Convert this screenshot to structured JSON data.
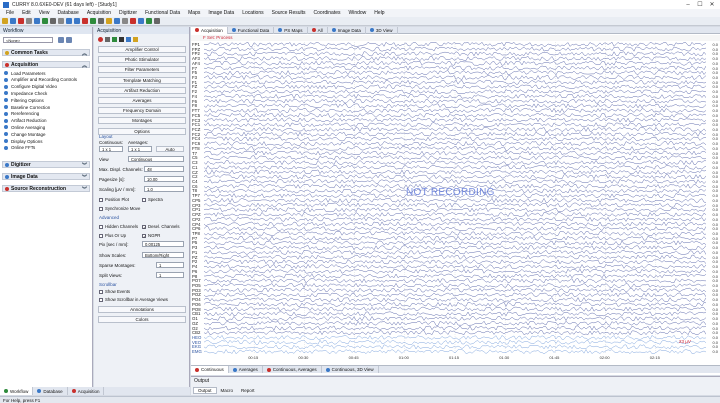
{
  "window": {
    "title": "CURRY 8.0.6XE0-DEV (61 days left) - [Study1]"
  },
  "menu": [
    "File",
    "Edit",
    "View",
    "Database",
    "Acquisition",
    "Digitizer",
    "Functional Data",
    "Maps",
    "Image Data",
    "Locations",
    "Source Results",
    "Coordinates",
    "Window",
    "Help"
  ],
  "workflow": {
    "title": "Workflow",
    "search_value": "<None>",
    "sections": [
      {
        "label": "Common Tasks",
        "color": "#d2a21f"
      },
      {
        "label": "Acquisition",
        "color": "#c9302c"
      }
    ],
    "acq_items": [
      "Load Parameters",
      "Amplifier and Recording Controls",
      "Configure Digital Video",
      "Impedance Check",
      "Filtering Options",
      "Baseline Correction",
      "Rereferencing",
      "Artifact Reduction",
      "Online Averaging",
      "Change Montage",
      "Display Options",
      "Online FFTs"
    ],
    "lower_sections": [
      {
        "label": "Digitizer",
        "color": "#3a78c7"
      },
      {
        "label": "Image Data",
        "color": "#3a78c7"
      },
      {
        "label": "Source Reconstruction",
        "color": "#c9302c"
      }
    ]
  },
  "acquisition": {
    "title": "Acquisition",
    "buttons": [
      "Amplifier Control",
      "Photic Stimulator",
      "Filter Parameters",
      "Template Matching",
      "Artifact Reduction",
      "Averages",
      "Frequency Domain",
      "Montages",
      "Options"
    ],
    "layout_group": "Layout",
    "continuous_label": "Continuous:",
    "averages_label": "Averages:",
    "continuous_value": "1 x 1",
    "averages_value": "1 x 1",
    "auto_label": "Auto",
    "view_label": "View",
    "view_value": "Continuous",
    "max_channels_label": "Max. Displ. Channels:",
    "max_channels_value": "48",
    "pagesize_label": "Pagesize [s]:",
    "pagesize_value": "10.00",
    "scaling_label": "Scaling [µV / mm]:",
    "scaling_value": "1.0",
    "position_plot": "Position Plot",
    "spectra": "Spectra",
    "sync_move": "Synchronize Move",
    "advanced_group": "Advanced",
    "hidden_channels": "Hidden Channels",
    "deselect_channels": "Desel. Channels",
    "plus_or_up": "Plus Or Up",
    "negp": "NGPR",
    "pix_label": "Pix [sec / mm]:",
    "pix_value": "0.00125",
    "show_scales_label": "Show Scales:",
    "show_scales_value": "Bottom/Right",
    "sparse_label": "Sparse Montages:",
    "sparse_value": "1",
    "split_label": "Split Views:",
    "split_value": "1",
    "scrollbar_group": "Scrollbar",
    "show_events": "Show Events",
    "show_scrollbar_avg": "Show Scrollbar in Average Views",
    "bottom_buttons": [
      "Annotations",
      "Colors"
    ]
  },
  "main": {
    "tabs": [
      {
        "label": "Acquisition",
        "color": "#c9302c"
      },
      {
        "label": "Functional Data",
        "color": "#3a78c7"
      },
      {
        "label": "PS Maps",
        "color": "#3a78c7"
      },
      {
        "label": "All",
        "color": "#c9302c"
      },
      {
        "label": "Image Data",
        "color": "#3a78c7"
      },
      {
        "label": "3D View",
        "color": "#3a78c7"
      }
    ],
    "header_label": "F Set: Process",
    "channels": [
      "FP1",
      "FPZ",
      "FP2",
      "AF3",
      "AF4",
      "F7",
      "F5",
      "F3",
      "F1",
      "FZ",
      "F2",
      "F4",
      "F6",
      "F8",
      "FT7",
      "FC5",
      "FC3",
      "FC1",
      "FCZ",
      "FC2",
      "FC4",
      "FC6",
      "FT8",
      "T7",
      "C5",
      "C3",
      "C1",
      "CZ",
      "C2",
      "C4",
      "C6",
      "T8",
      "TP7",
      "CP5",
      "CP3",
      "CP1",
      "CPZ",
      "CP2",
      "CP4",
      "CP6",
      "TP8",
      "P7",
      "P5",
      "P3",
      "P1",
      "PZ",
      "P2",
      "P4",
      "P6",
      "P8",
      "PO7",
      "PO5",
      "PO3",
      "POZ",
      "PO4",
      "PO6",
      "PO8",
      "CB1",
      "O1",
      "OZ",
      "O2",
      "CB2",
      "HEO",
      "VEO",
      "EKG",
      "EMG"
    ],
    "scale_values": [
      "0.0",
      "0.0",
      "0.0",
      "0.0",
      "0.0",
      "0.0",
      "0.0",
      "0.0",
      "0.0",
      "0.0",
      "0.0",
      "0.0",
      "0.0",
      "0.0",
      "0.0",
      "0.0",
      "0.0",
      "0.0",
      "0.0",
      "0.0",
      "0.0",
      "0.0",
      "0.0",
      "0.0",
      "0.0",
      "0.0",
      "0.0",
      "0.0",
      "0.0",
      "0.0",
      "0.0",
      "0.0",
      "0.0",
      "0.0",
      "0.0",
      "0.0",
      "0.0",
      "0.0",
      "0.0",
      "0.0",
      "0.0",
      "0.0",
      "0.0",
      "0.0",
      "0.0",
      "0.0",
      "0.0",
      "0.0",
      "0.0",
      "0.0",
      "0.0",
      "0.0",
      "0.0",
      "0.0",
      "0.0",
      "0.0",
      "0.0",
      "0.0",
      "0.0",
      "0.0",
      "0.0",
      "0.0",
      "0.0",
      "0.0",
      "0.0",
      "0.0"
    ],
    "watermark": "NOT RECORDING",
    "amplitude_label": "23 µV",
    "time_labels": [
      "00:15",
      "00:30",
      "00:45",
      "01:00",
      "01:15",
      "01:30",
      "01:45",
      "02:00",
      "02:15"
    ],
    "bottom_tabs": [
      {
        "label": "Continuous",
        "color": "#c9302c"
      },
      {
        "label": "Averages",
        "color": "#3a78c7"
      },
      {
        "label": "Continuous, Averages",
        "color": "#c9302c"
      },
      {
        "label": "Continuous, 3D View",
        "color": "#3a78c7"
      }
    ]
  },
  "output": {
    "title": "Output",
    "tabs": [
      "Output",
      "Macro",
      "Report"
    ]
  },
  "dock_tabs": [
    {
      "label": "Workflow",
      "color": "#2e8b3c"
    },
    {
      "label": "Database",
      "color": "#3a78c7"
    },
    {
      "label": "Acquisition",
      "color": "#c9302c"
    }
  ],
  "status": {
    "text": "For Help, press F1"
  }
}
